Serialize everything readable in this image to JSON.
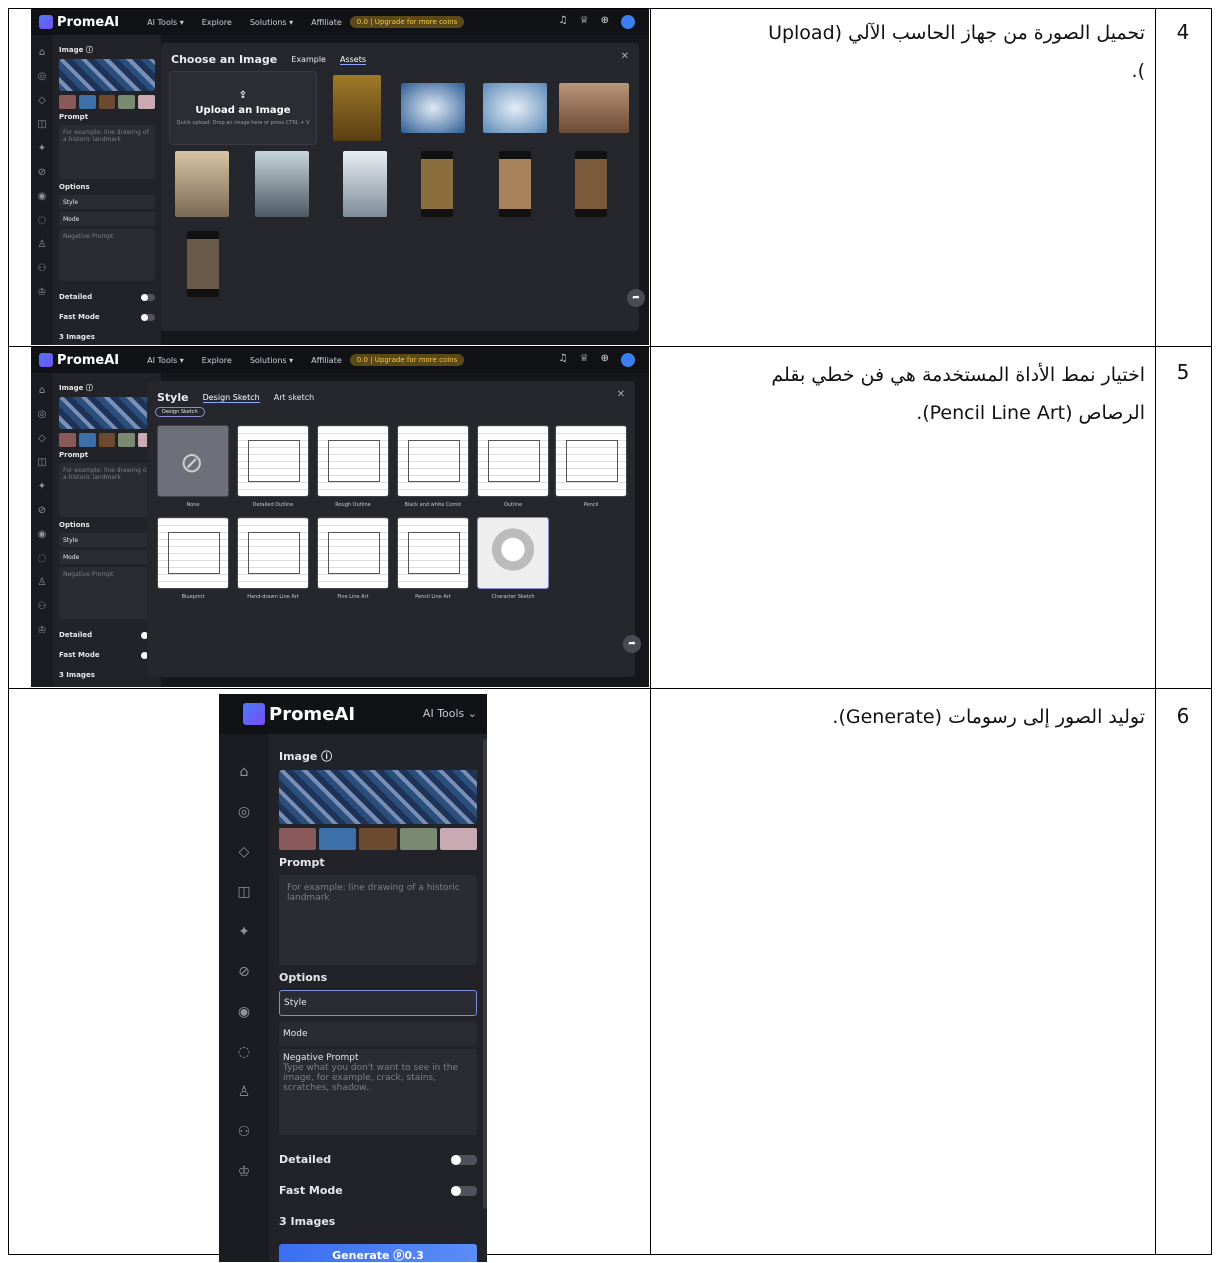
{
  "rows": [
    {
      "number": "4",
      "description_rtl": "تحميل الصورة من جهاز الحاسب الآلي (Upload",
      "description_rtl_2": ")."
    },
    {
      "number": "5",
      "description_rtl": "اختيار نمط الأداة المستخدمة هي فن خطي بقلم",
      "description_rtl_2": "الرصاص (Pencil Line Art)."
    },
    {
      "number": "6",
      "description_rtl": "توليد الصور إلى رسومات (Generate).",
      "description_rtl_2": ""
    }
  ],
  "app": {
    "brand": "PromeAI",
    "nav": [
      "AI Tools ▾",
      "Explore",
      "Solutions ▾",
      "Affiliate"
    ],
    "coins_badge": "0.0 | Upgrade for more coins",
    "panel": {
      "image_label": "Image ⓘ",
      "prompt_label": "Prompt",
      "prompt_placeholder": "For example: line drawing of a historic landmark",
      "options_label": "Options",
      "style_label": "Style",
      "mode_label": "Mode",
      "negative_label": "Negative Prompt",
      "negative_placeholder": "Type what you don't want to see in the image, for example, crack, stains, scratches, shadow..",
      "detailed_label": "Detailed",
      "fast_mode_label": "Fast Mode",
      "images_label": "3 Images",
      "generate_label": "Generate ⓟ0.3"
    }
  },
  "upload_modal": {
    "title": "Choose an Image",
    "tabs": [
      "Example",
      "Assets"
    ],
    "upload_title": "Upload an Image",
    "upload_hint": "Quick upload: Drop an image here or press CTRL + V"
  },
  "style_modal": {
    "title": "Style",
    "tabs": [
      "Design Sketch",
      "Art sketch"
    ],
    "chip": "Design Sketch",
    "styles": [
      "None",
      "Detailed Outline",
      "Rough Outline",
      "Black and white Comic",
      "Outline",
      "Pencil",
      "Blueprint",
      "Hand-drawn Line Art",
      "Fine Line Art",
      "Pencil Line Art",
      "Character Sketch"
    ]
  },
  "big_panel": {
    "brand": "PromeAI",
    "ai_tools": "AI Tools ⌄"
  }
}
